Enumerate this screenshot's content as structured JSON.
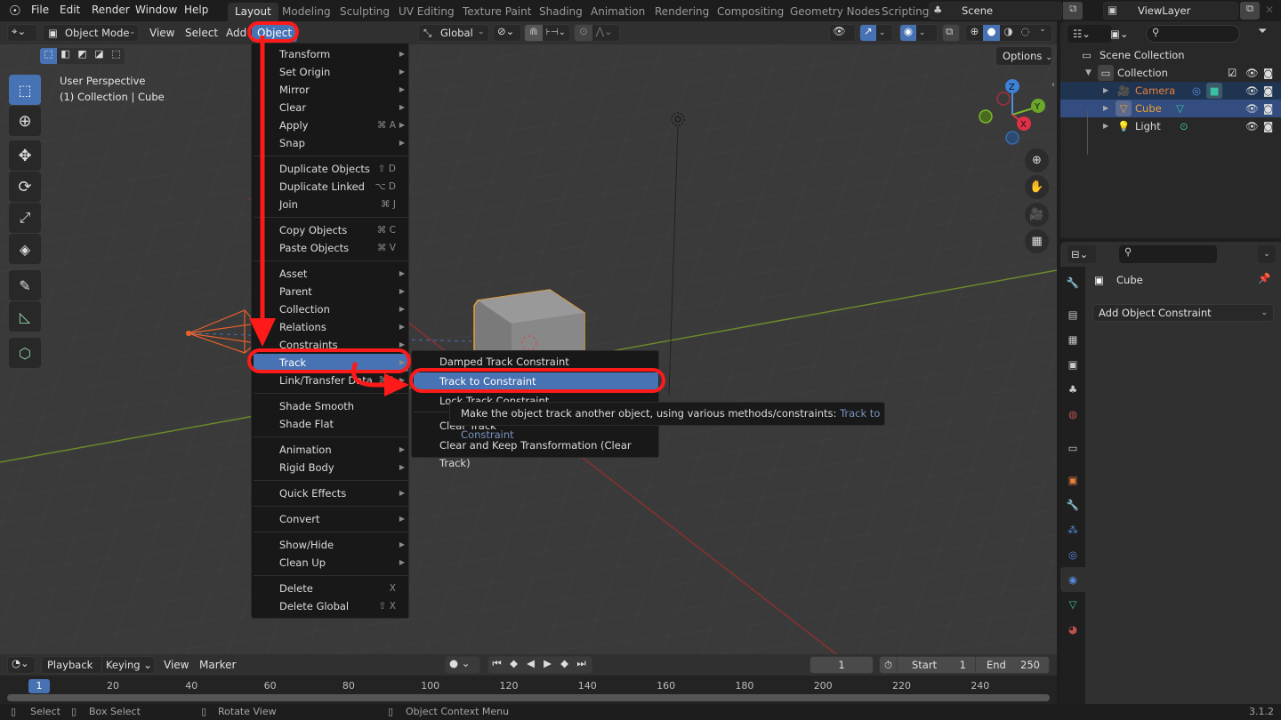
{
  "app": {
    "name": "Blender",
    "version": "3.1.2"
  },
  "topbar": {
    "menus": [
      "File",
      "Edit",
      "Render",
      "Window",
      "Help"
    ],
    "workspaces": [
      "Layout",
      "Modeling",
      "Sculpting",
      "UV Editing",
      "Texture Paint",
      "Shading",
      "Animation",
      "Rendering",
      "Compositing",
      "Geometry Nodes",
      "Scripting"
    ],
    "active_workspace": "Layout",
    "scene": "Scene",
    "view_layer": "ViewLayer"
  },
  "viewport_header": {
    "mode": "Object Mode",
    "menus": [
      "View",
      "Select",
      "Add",
      "Object"
    ],
    "active_menu": "Object",
    "transform_orientation": "Global",
    "options_label": "Options"
  },
  "viewport": {
    "view_name": "User Perspective",
    "collection_info": "(1) Collection | Cube",
    "gizmo_axes": [
      "Z",
      "Y",
      "X"
    ]
  },
  "object_menu": {
    "items": [
      {
        "label": "Transform",
        "shortcut": "",
        "submenu": true
      },
      {
        "label": "Set Origin",
        "shortcut": "",
        "submenu": true
      },
      {
        "label": "Mirror",
        "shortcut": "",
        "submenu": true
      },
      {
        "label": "Clear",
        "shortcut": "",
        "submenu": true
      },
      {
        "label": "Apply",
        "shortcut": "⌘ A",
        "submenu": true
      },
      {
        "label": "Snap",
        "shortcut": "",
        "submenu": true
      },
      {
        "label": "Duplicate Objects",
        "shortcut": "⇧ D",
        "submenu": false
      },
      {
        "label": "Duplicate Linked",
        "shortcut": "⌥ D",
        "submenu": false
      },
      {
        "label": "Join",
        "shortcut": "⌘ J",
        "submenu": false
      },
      {
        "label": "Copy Objects",
        "shortcut": "⌘ C",
        "submenu": false
      },
      {
        "label": "Paste Objects",
        "shortcut": "⌘ V",
        "submenu": false
      },
      {
        "label": "Asset",
        "shortcut": "",
        "submenu": true
      },
      {
        "label": "Parent",
        "shortcut": "",
        "submenu": true
      },
      {
        "label": "Collection",
        "shortcut": "",
        "submenu": true
      },
      {
        "label": "Relations",
        "shortcut": "",
        "submenu": true
      },
      {
        "label": "Constraints",
        "shortcut": "",
        "submenu": true
      },
      {
        "label": "Track",
        "shortcut": "",
        "submenu": true
      },
      {
        "label": "Link/Transfer Data",
        "shortcut": "⌘ L",
        "submenu": true
      },
      {
        "label": "Shade Smooth",
        "shortcut": "",
        "submenu": false
      },
      {
        "label": "Shade Flat",
        "shortcut": "",
        "submenu": false
      },
      {
        "label": "Animation",
        "shortcut": "",
        "submenu": true
      },
      {
        "label": "Rigid Body",
        "shortcut": "",
        "submenu": true
      },
      {
        "label": "Quick Effects",
        "shortcut": "",
        "submenu": true
      },
      {
        "label": "Convert",
        "shortcut": "",
        "submenu": true
      },
      {
        "label": "Show/Hide",
        "shortcut": "",
        "submenu": true
      },
      {
        "label": "Clean Up",
        "shortcut": "",
        "submenu": true
      },
      {
        "label": "Delete",
        "shortcut": "X",
        "submenu": false
      },
      {
        "label": "Delete Global",
        "shortcut": "⇧ X",
        "submenu": false
      }
    ],
    "highlighted": "Track"
  },
  "track_submenu": {
    "items": [
      "Damped Track Constraint",
      "Track to Constraint",
      "Lock Track Constraint",
      "Clear Track",
      "Clear and Keep Transformation (Clear Track)"
    ],
    "highlighted": "Track to Constraint"
  },
  "tooltip": {
    "text": "Make the object track another object, using various methods/constraints:",
    "python": "Track to Constraint"
  },
  "outliner": {
    "root": "Scene Collection",
    "collection": "Collection",
    "objects": [
      {
        "name": "Camera",
        "color": "#e8813a",
        "selected": true
      },
      {
        "name": "Cube",
        "color": "#f0a030",
        "selected": true,
        "active": true
      },
      {
        "name": "Light",
        "color": "#d0d0d0",
        "selected": false
      }
    ]
  },
  "properties": {
    "object_name": "Cube",
    "add_constraint_label": "Add Object Constraint"
  },
  "timeline": {
    "menus": [
      "Playback",
      "Keying",
      "View",
      "Marker"
    ],
    "current_frame": "1",
    "start_label": "Start",
    "start": "1",
    "end_label": "End",
    "end": "250",
    "ticks": [
      "20",
      "40",
      "60",
      "80",
      "100",
      "120",
      "140",
      "160",
      "180",
      "200",
      "220",
      "240"
    ],
    "playhead": "1"
  },
  "statusbar": {
    "hints": [
      "Select",
      "Box Select",
      "Rotate View",
      "Object Context Menu"
    ],
    "version": "3.1.2"
  },
  "colors": {
    "accent": "#4772b3",
    "annotation": "#ff1a1a",
    "selected_orange": "#f0a030"
  }
}
